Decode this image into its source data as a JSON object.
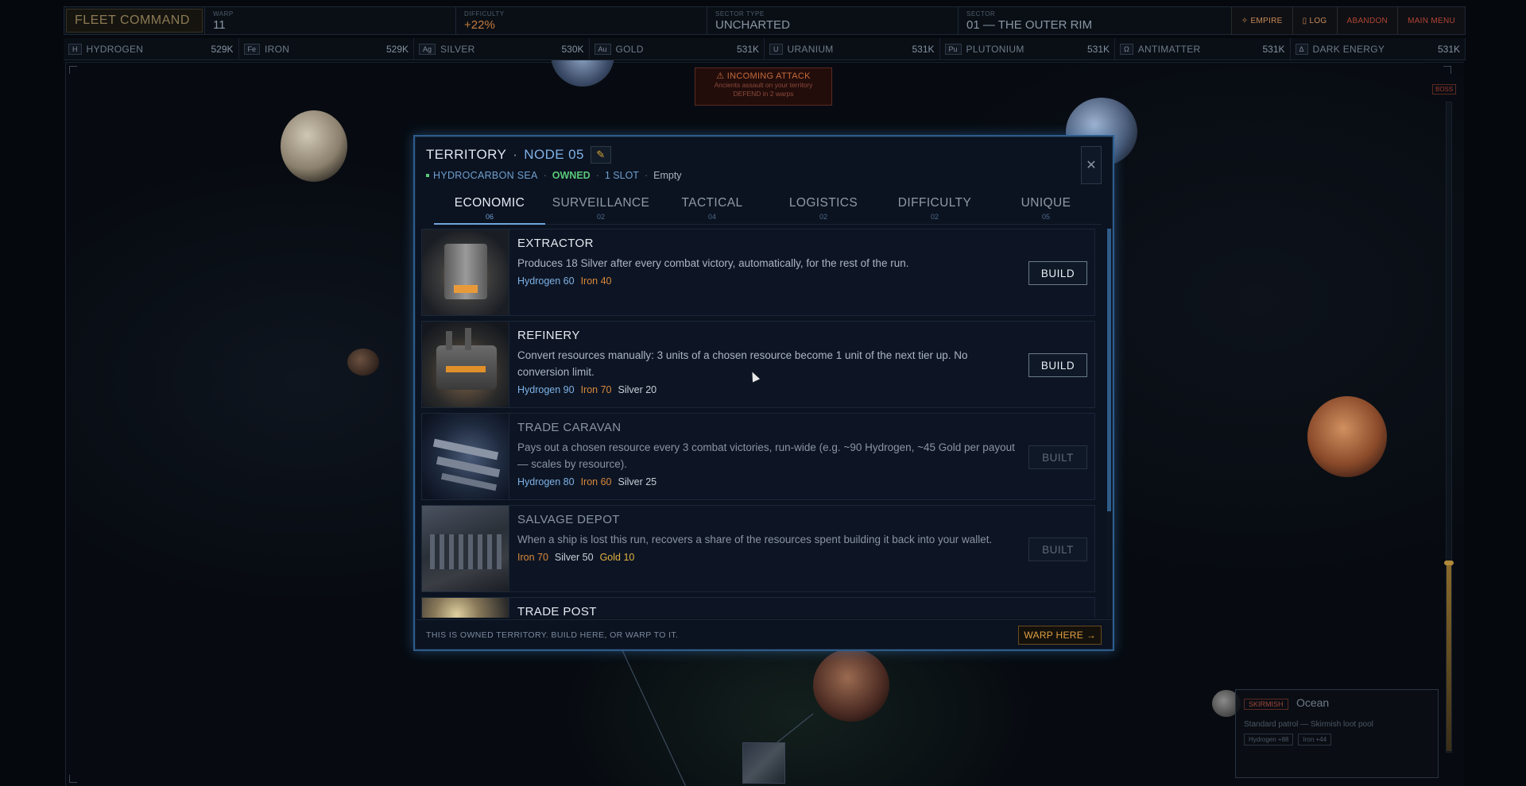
{
  "hud": {
    "fleet_title": "FLEET COMMAND",
    "stats": [
      {
        "label": "WARP",
        "value": "11"
      },
      {
        "label": "DIFFICULTY",
        "value": "+22%"
      },
      {
        "label": "SECTOR TYPE",
        "value": "UNCHARTED"
      },
      {
        "label": "SECTOR",
        "value": "01 — THE OUTER RIM"
      }
    ],
    "buttons": {
      "empire": "✧ EMPIRE",
      "log": "▯ LOG",
      "abandon": "ABANDON",
      "main_menu": "MAIN MENU"
    }
  },
  "resources": [
    {
      "symbol": "H",
      "name": "HYDROGEN",
      "amount": "529K"
    },
    {
      "symbol": "Fe",
      "name": "IRON",
      "amount": "529K"
    },
    {
      "symbol": "Ag",
      "name": "SILVER",
      "amount": "530K"
    },
    {
      "symbol": "Au",
      "name": "GOLD",
      "amount": "531K"
    },
    {
      "symbol": "U",
      "name": "URANIUM",
      "amount": "531K"
    },
    {
      "symbol": "Pu",
      "name": "PLUTONIUM",
      "amount": "531K"
    },
    {
      "symbol": "Ω",
      "name": "ANTIMATTER",
      "amount": "531K"
    },
    {
      "symbol": "Δ",
      "name": "DARK ENERGY",
      "amount": "531K"
    }
  ],
  "alert": {
    "title": "⚠ INCOMING ATTACK",
    "line1": "Ancients assault on your territory",
    "line2": "DEFEND in 2 warps"
  },
  "boss_label": "BOSS",
  "skirmish": {
    "tag": "SKIRMISH",
    "title": "Ocean",
    "desc": "Standard patrol — Skirmish loot pool",
    "chip1": "Hydrogen +88",
    "chip2": "Iron +44"
  },
  "modal": {
    "title": "TERRITORY",
    "dot": "·",
    "node": "NODE 05",
    "edit_icon": "✎",
    "close": "✕",
    "sub": {
      "sea": "HYDROCARBON SEA",
      "sep": "·",
      "owned": "OWNED",
      "slot": "1 SLOT",
      "empty": "Empty"
    },
    "tabs": [
      {
        "label": "ECONOMIC",
        "count": "06"
      },
      {
        "label": "SURVEILLANCE",
        "count": "02"
      },
      {
        "label": "TACTICAL",
        "count": "04"
      },
      {
        "label": "LOGISTICS",
        "count": "02"
      },
      {
        "label": "DIFFICULTY",
        "count": "02"
      },
      {
        "label": "UNIQUE",
        "count": "05"
      }
    ],
    "items": [
      {
        "name": "EXTRACTOR",
        "desc": "Produces 18 Silver after every combat victory, automatically, for the rest of the run.",
        "cost": {
          "h": "Hydrogen 60",
          "fe": "Iron 40"
        },
        "action": "BUILD"
      },
      {
        "name": "REFINERY",
        "desc": "Convert resources manually: 3 units of a chosen resource become 1 unit of the next tier up. No conversion limit.",
        "cost": {
          "h": "Hydrogen 90",
          "fe": "Iron 70",
          "ag": "Silver 20"
        },
        "action": "BUILD"
      },
      {
        "name": "TRADE CARAVAN",
        "desc": "Pays out a chosen resource every 3 combat victories, run-wide (e.g. ~90 Hydrogen, ~45 Gold per payout — scales by resource).",
        "cost": {
          "h": "Hydrogen 80",
          "fe": "Iron 60",
          "ag": "Silver 25"
        },
        "action": "BUILT"
      },
      {
        "name": "SALVAGE DEPOT",
        "desc": "When a ship is lost this run, recovers a share of the resources spent building it back into your wallet.",
        "cost": {
          "fe": "Iron 70",
          "ag": "Silver 50",
          "au": "Gold 10"
        },
        "action": "BUILT"
      },
      {
        "name": "TRADE POST",
        "desc": "",
        "cost": {},
        "action": ""
      }
    ],
    "footer": "THIS IS OWNED TERRITORY. BUILD HERE, OR WARP TO IT.",
    "warp_button": "WARP HERE →"
  }
}
